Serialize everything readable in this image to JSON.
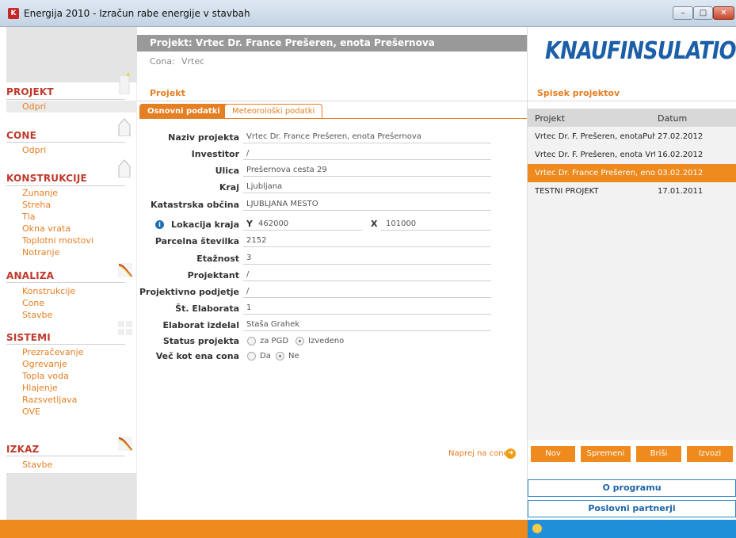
{
  "window": {
    "title": "Energija 2010 - Izračun rabe energije v stavbah",
    "minimize": "–",
    "maximize": "□",
    "close": "✕",
    "app_icon": "K"
  },
  "header": {
    "project_title": "Projekt: Vrtec Dr. France Prešeren, enota Prešernova",
    "cona_label": "Cona:",
    "cona_value": "Vrtec"
  },
  "sidebar": {
    "sections": [
      {
        "title": "PROJEKT",
        "items": [
          "Odpri"
        ]
      },
      {
        "title": "CONE",
        "items": [
          "Odpri"
        ]
      },
      {
        "title": "KONSTRUKCIJE",
        "items": [
          "Zunanje",
          "Streha",
          "Tla",
          "Okna vrata",
          "Toplotni mostovi",
          "Notranje"
        ]
      },
      {
        "title": "ANALIZA",
        "items": [
          "Konstrukcije",
          "Cone",
          "Stavbe"
        ]
      },
      {
        "title": "SISTEMI",
        "items": [
          "Prezračevanje",
          "Ogrevanje",
          "Topla voda",
          "Hlajenje",
          "Razsvetljava",
          "OVE"
        ]
      },
      {
        "title": "IZKAZ",
        "items": [
          "Stavbe"
        ]
      }
    ]
  },
  "main": {
    "section_title": "Projekt",
    "tabs": [
      {
        "label": "Osnovni podatki",
        "active": true
      },
      {
        "label": "Meteorološki podatki",
        "active": false
      }
    ],
    "form": {
      "naziv_label": "Naziv projekta",
      "naziv_value": "Vrtec Dr. France Prešeren, enota Prešernova",
      "investitor_label": "Investitor",
      "investitor_value": "/",
      "ulica_label": "Ulica",
      "ulica_value": "Prešernova cesta 29",
      "kraj_label": "Kraj",
      "kraj_value": "Ljubljana",
      "obcina_label": "Katastrska občina",
      "obcina_value": "LJUBLJANA MESTO",
      "lokacija_label": "Lokacija kraja",
      "y_label": "Y",
      "y_value": "462000",
      "x_label": "X",
      "x_value": "101000",
      "parcela_label": "Parcelna številka",
      "parcela_value": "2152",
      "etaznost_label": "Etažnost",
      "etaznost_value": "3",
      "projektant_label": "Projektant",
      "projektant_value": "/",
      "podjetje_label": "Projektivno podjetje",
      "podjetje_value": "/",
      "elaborat_label": "Št. Elaborata",
      "elaborat_value": "1",
      "izdelal_label": "Elaborat izdelal",
      "izdelal_value": "Staša Grahek",
      "status_label": "Status projekta",
      "status_opt1": "za PGD",
      "status_opt2": "Izvedeno",
      "status_selected": "Izvedeno",
      "vec_label": "Več kot ena cona",
      "vec_opt1": "Da",
      "vec_opt2": "Ne",
      "vec_selected": "Ne"
    },
    "next_link": "Naprej na cone"
  },
  "right": {
    "logo_bold": "KNAUF",
    "logo_rest": "INSULATION",
    "title": "Spisek projektov",
    "columns": [
      "Projekt",
      "Datum"
    ],
    "rows": [
      {
        "name": "Vrtec Dr. F. Prešeren, enotaPuhar",
        "date": "27.02.2012",
        "selected": false
      },
      {
        "name": "Vrtec Dr. F. Prešeren, enota Vrtač",
        "date": "16.02.2012",
        "selected": false
      },
      {
        "name": "Vrtec Dr. France Prešeren, enota",
        "date": "03.02.2012",
        "selected": true
      },
      {
        "name": "TESTNI PROJEKT",
        "date": "17.01.2011",
        "selected": false
      }
    ],
    "buttons": [
      "Nov",
      "Spremeni",
      "Briši",
      "Izvozi"
    ],
    "about": "O programu",
    "partners": "Poslovni partnerji"
  },
  "colors": {
    "accent": "#ee8a1e",
    "section": "#c0392b",
    "link_blue": "#1e8fd8"
  }
}
